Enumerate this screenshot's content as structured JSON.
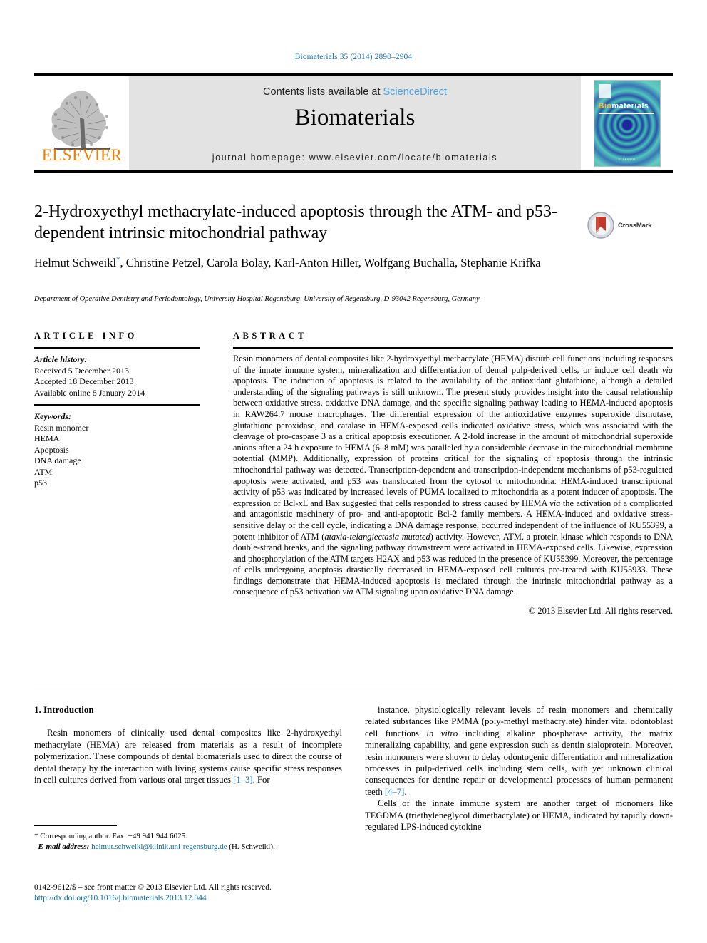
{
  "running_head": "Biomaterials 35 (2014) 2890–2904",
  "banner": {
    "contents_prefix": "Contents lists available at",
    "sciencedirect": "ScienceDirect",
    "journal_title": "Biomaterials",
    "homepage": "journal homepage: www.elsevier.com/locate/biomaterials",
    "publisher_logo_text": "ELSEVIER",
    "cover": {
      "title_bio": "Bio",
      "title_materials": "materials",
      "footer": "ELSEVIER"
    }
  },
  "article": {
    "title": "2-Hydroxyethyl methacrylate-induced apoptosis through the ATM- and p53-dependent intrinsic mitochondrial pathway",
    "authors": "Helmut Schweikl, Christine Petzel, Carola Bolay, Karl-Anton Hiller, Wolfgang Buchalla, Stephanie Krifka",
    "author_marker": "*",
    "affiliation": "Department of Operative Dentistry and Periodontology, University Hospital Regensburg, University of Regensburg, D-93042 Regensburg, Germany",
    "crossmark_label": "CrossMark"
  },
  "article_info": {
    "heading": "ARTICLE INFO",
    "history_label": "Article history:",
    "history": [
      "Received 5 December 2013",
      "Accepted 18 December 2013",
      "Available online 8 January 2014"
    ],
    "keywords_label": "Keywords:",
    "keywords": [
      "Resin monomer",
      "HEMA",
      "Apoptosis",
      "DNA damage",
      "ATM",
      "p53"
    ]
  },
  "abstract": {
    "heading": "ABSTRACT",
    "text_parts": [
      {
        "t": "Resin monomers of dental composites like 2-hydroxyethyl methacrylate (HEMA) disturb cell functions including responses of the innate immune system, mineralization and differentiation of dental pulp-derived cells, or induce cell death "
      },
      {
        "t": "via",
        "i": true
      },
      {
        "t": " apoptosis. The induction of apoptosis is related to the availability of the antioxidant glutathione, although a detailed understanding of the signaling pathways is still unknown. The present study provides insight into the causal relationship between oxidative stress, oxidative DNA damage, and the specific signaling pathway leading to HEMA-induced apoptosis in RAW264.7 mouse macrophages. The differential expression of the antioxidative enzymes superoxide dismutase, glutathione peroxidase, and catalase in HEMA-exposed cells indicated oxidative stress, which was associated with the cleavage of pro-caspase 3 as a critical apoptosis executioner. A 2-fold increase in the amount of mitochondrial superoxide anions after a 24 h exposure to HEMA (6–8 mM) was paralleled by a considerable decrease in the mitochondrial membrane potential (MMP). Additionally, expression of proteins critical for the signaling of apoptosis through the intrinsic mitochondrial pathway was detected. Transcription-dependent and transcription-independent mechanisms of p53-regulated apoptosis were activated, and p53 was translocated from the cytosol to mitochondria. HEMA-induced transcriptional activity of p53 was indicated by increased levels of PUMA localized to mitochondria as a potent inducer of apoptosis. The expression of Bcl-xL and Bax suggested that cells responded to stress caused by HEMA "
      },
      {
        "t": "via",
        "i": true
      },
      {
        "t": " the activation of a complicated and antagonistic machinery of pro- and anti-apoptotic Bcl-2 family members. A HEMA-induced and oxidative stress-sensitive delay of the cell cycle, indicating a DNA damage response, occurred independent of the influence of KU55399, a potent inhibitor of ATM ("
      },
      {
        "t": "ataxia-telangiectasia mutated",
        "i": true
      },
      {
        "t": ") activity. However, ATM, a protein kinase which responds to DNA double-strand breaks, and the signaling pathway downstream were activated in HEMA-exposed cells. Likewise, expression and phosphorylation of the ATM targets H2AX and p53 was reduced in the presence of KU55399. Moreover, the percentage of cells undergoing apoptosis drastically decreased in HEMA-exposed cell cultures pre-treated with KU55933. These findings demonstrate that HEMA-induced apoptosis is mediated through the intrinsic mitochondrial pathway as a consequence of p53 activation "
      },
      {
        "t": "via",
        "i": true
      },
      {
        "t": " ATM signaling upon oxidative DNA damage."
      }
    ],
    "copyright": "© 2013 Elsevier Ltd. All rights reserved."
  },
  "introduction": {
    "heading": "1. Introduction",
    "left_paragraph_parts": [
      {
        "t": "Resin monomers of clinically used dental composites like 2-hydroxyethyl methacrylate (HEMA) are released from materials as a result of incomplete polymerization. These compounds of dental biomaterials used to direct the course of dental therapy by the interaction with living systems cause specific stress responses in cell cultures derived from various oral target tissues "
      },
      {
        "t": "[1–3]",
        "cite": true
      },
      {
        "t": ". For"
      }
    ],
    "right_paragraph1_parts": [
      {
        "t": "instance, physiologically relevant levels of resin monomers and chemically related substances like PMMA (poly-methyl methacrylate) hinder vital odontoblast cell functions "
      },
      {
        "t": "in vitro",
        "i": true
      },
      {
        "t": " including alkaline phosphatase activity, the matrix mineralizing capability, and gene expression such as dentin sialoprotein. Moreover, resin monomers were shown to delay odontogenic differentiation and mineralization processes in pulp-derived cells including stem cells, with yet unknown clinical consequences for dentine repair or developmental processes of human permanent teeth "
      },
      {
        "t": "[4–7]",
        "cite": true
      },
      {
        "t": "."
      }
    ],
    "right_paragraph2": "Cells of the innate immune system are another target of monomers like TEGDMA (triethyleneglycol dimethacrylate) or HEMA, indicated by rapidly down-regulated LPS-induced cytokine"
  },
  "footnote": {
    "corresponding": "* Corresponding author. Fax: +49 941 944 6025.",
    "email_label": "E-mail address:",
    "email": "helmut.schweikl@klinik.uni-regensburg.de",
    "email_suffix": "(H. Schweikl)."
  },
  "imprint": {
    "line1": "0142-9612/$ – see front matter © 2013 Elsevier Ltd. All rights reserved.",
    "doi": "http://dx.doi.org/10.1016/j.biomaterials.2013.12.044"
  }
}
